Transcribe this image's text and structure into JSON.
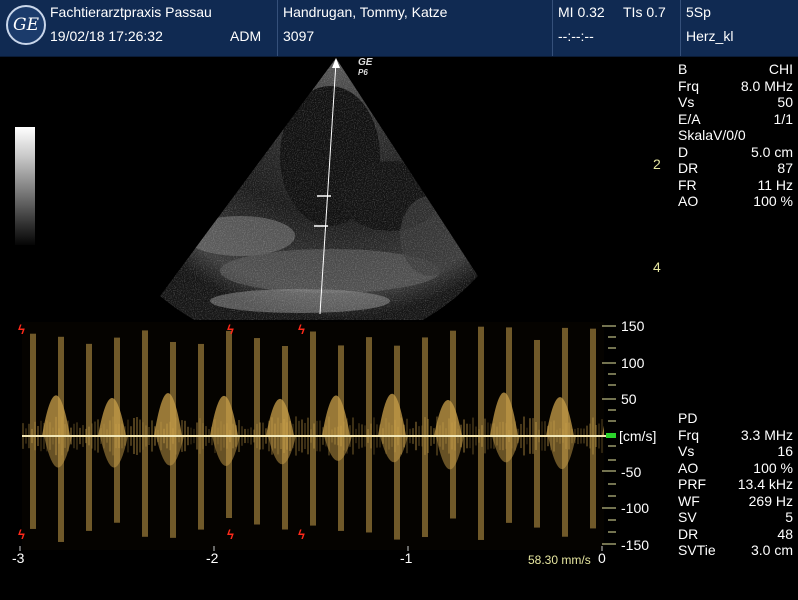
{
  "header": {
    "logo_text": "GE",
    "institution": "Fachtierarztpraxis Passau",
    "datetime": "19/02/18 17:26:32",
    "operator": "ADM",
    "patient": "Handrugan, Tommy, Katze",
    "patient_id": "3097",
    "mi": "MI 0.32",
    "tis": "TIs 0.7",
    "probe": "5Sp",
    "time_placeholder": "--:--:--",
    "preset": "Herz_kl"
  },
  "image": {
    "probe_brand": "GE",
    "probe_mark": "P6",
    "depth_labels": [
      "2",
      "4"
    ]
  },
  "bmode_params": [
    {
      "k": "B",
      "v": "CHI"
    },
    {
      "k": "Frq",
      "v": "8.0 MHz"
    },
    {
      "k": "Vs",
      "v": "50"
    },
    {
      "k": "E/A",
      "v": "1/1"
    },
    {
      "k": "SkalaV/0/0",
      "v": ""
    },
    {
      "k": "D",
      "v": "5.0 cm"
    },
    {
      "k": "DR",
      "v": "87"
    },
    {
      "k": "FR",
      "v": "11 Hz"
    },
    {
      "k": "AO",
      "v": "100 %"
    }
  ],
  "doppler_params": [
    {
      "k": "PD",
      "v": ""
    },
    {
      "k": "Frq",
      "v": "3.3 MHz"
    },
    {
      "k": "Vs",
      "v": "16"
    },
    {
      "k": "AO",
      "v": "100 %"
    },
    {
      "k": "PRF",
      "v": "13.4 kHz"
    },
    {
      "k": "WF",
      "v": "269 Hz"
    },
    {
      "k": "SV",
      "v": "5"
    },
    {
      "k": "DR",
      "v": "48"
    },
    {
      "k": "SVTie",
      "v": "3.0 cm"
    }
  ],
  "doppler": {
    "velocity_labels": [
      "150",
      "100",
      "50",
      "[cm/s]",
      "-50",
      "-100",
      "-150"
    ],
    "time_labels": [
      "-3",
      "-2",
      "-1",
      "0"
    ],
    "sweep_speed": "58.30 mm/s",
    "colors": {
      "spectrum": "#c9a04a",
      "baseline": "#f2e6b4",
      "ecg_marker": "#ff2a1a",
      "scale": "#e6e6a0"
    }
  }
}
